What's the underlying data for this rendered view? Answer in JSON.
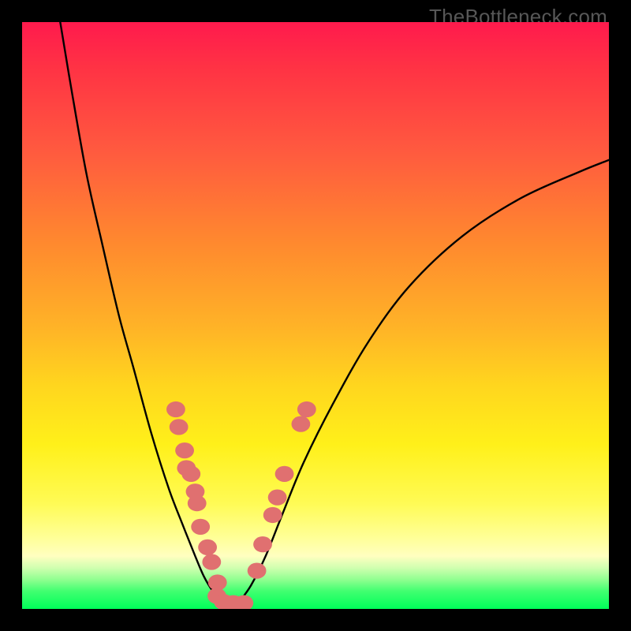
{
  "watermark_text": "TheBottleneck.com",
  "colors": {
    "frame_background": "#000000",
    "curve_stroke": "#000000",
    "dot_fill": "#e07070",
    "watermark_color": "#575757",
    "gradient_stops": [
      "#ff1a4d",
      "#ff3344",
      "#ff5a3f",
      "#ff8a2e",
      "#ffb327",
      "#ffd61e",
      "#fff01a",
      "#fffb55",
      "#ffff99",
      "#ffffc0",
      "#d0ffb0",
      "#90ff90",
      "#40ff70",
      "#00ff5a"
    ]
  },
  "chart_data": {
    "type": "line",
    "title": "",
    "xlabel": "",
    "ylabel": "",
    "xlim": [
      0,
      100
    ],
    "ylim": [
      0,
      100
    ],
    "grid": false,
    "legend": false,
    "series": [
      {
        "name": "left-curve",
        "x": [
          6.5,
          8.5,
          11,
          13.7,
          16.5,
          19,
          22,
          25,
          27.3,
          29.5,
          31,
          32.5,
          34
        ],
        "y": [
          100,
          88,
          74,
          62,
          50,
          41,
          30,
          20.5,
          14.5,
          9,
          5.5,
          3,
          1.2
        ]
      },
      {
        "name": "right-curve",
        "x": [
          37,
          39,
          41.5,
          44.5,
          48,
          53,
          59,
          66,
          75,
          85,
          95,
          100
        ],
        "y": [
          1.2,
          4,
          9,
          16.5,
          25,
          35,
          45.5,
          55,
          63.5,
          70,
          74.5,
          76.5
        ]
      },
      {
        "name": "valley-floor",
        "x": [
          32.5,
          34,
          35.5,
          37,
          38.5
        ],
        "y": [
          1.2,
          0.8,
          0.8,
          0.9,
          1.2
        ]
      }
    ],
    "scatter_points": {
      "name": "dots",
      "points": [
        {
          "x": 26.2,
          "y": 34.0,
          "r": 1.6
        },
        {
          "x": 26.7,
          "y": 31.0,
          "r": 1.6
        },
        {
          "x": 27.7,
          "y": 27.0,
          "r": 1.6
        },
        {
          "x": 28.0,
          "y": 24.0,
          "r": 1.6
        },
        {
          "x": 28.8,
          "y": 23.0,
          "r": 1.6
        },
        {
          "x": 29.5,
          "y": 20.0,
          "r": 1.6
        },
        {
          "x": 29.8,
          "y": 18.0,
          "r": 1.6
        },
        {
          "x": 30.4,
          "y": 14.0,
          "r": 1.6
        },
        {
          "x": 31.6,
          "y": 10.5,
          "r": 1.6
        },
        {
          "x": 32.3,
          "y": 8.0,
          "r": 1.6
        },
        {
          "x": 33.3,
          "y": 4.5,
          "r": 1.6
        },
        {
          "x": 33.2,
          "y": 2.2,
          "r": 1.6
        },
        {
          "x": 34.3,
          "y": 1.2,
          "r": 1.6
        },
        {
          "x": 36.0,
          "y": 1.0,
          "r": 1.6
        },
        {
          "x": 37.8,
          "y": 1.0,
          "r": 1.6
        },
        {
          "x": 40.0,
          "y": 6.5,
          "r": 1.6
        },
        {
          "x": 41.0,
          "y": 11.0,
          "r": 1.6
        },
        {
          "x": 42.7,
          "y": 16.0,
          "r": 1.6
        },
        {
          "x": 43.5,
          "y": 19.0,
          "r": 1.6
        },
        {
          "x": 44.7,
          "y": 23.0,
          "r": 1.6
        },
        {
          "x": 47.5,
          "y": 31.5,
          "r": 1.6
        },
        {
          "x": 48.5,
          "y": 34.0,
          "r": 1.6
        }
      ]
    },
    "notes": "V-shaped bottleneck curve over red-to-green vertical gradient. Values are estimates read from pixel positions; no labeled axes in source."
  }
}
